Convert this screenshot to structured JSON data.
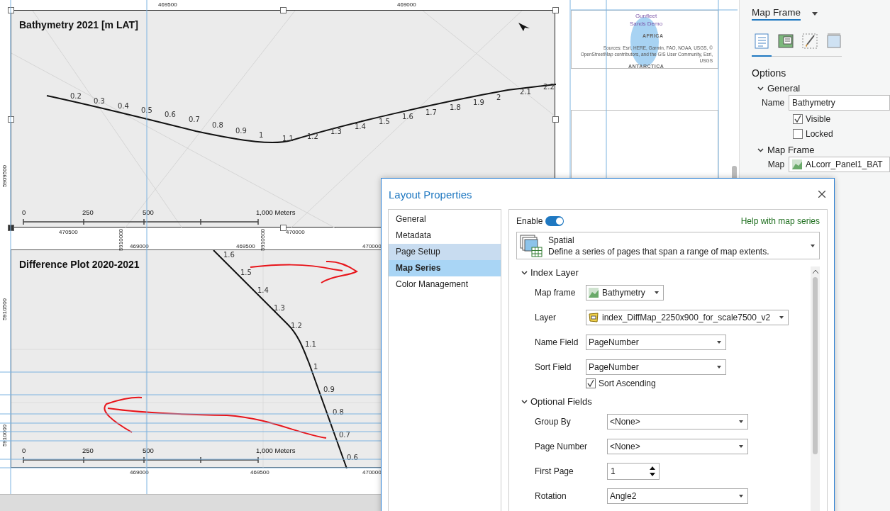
{
  "layout_page": {
    "maps": [
      {
        "title": "Bathymetry 2021 [m LAT]",
        "selected": true,
        "contour_labels": [
          "0.2",
          "0.3",
          "0.4",
          "0.5",
          "0.6",
          "0.7",
          "0.8",
          "0.9",
          "1",
          "1.1",
          "1.2",
          "1.3",
          "1.4",
          "1.5",
          "1.6",
          "1.7",
          "1.8",
          "1.9",
          "2",
          "2.1",
          "2.2"
        ],
        "grid_labels": [
          "469500",
          "469000",
          "470500",
          "470000",
          "5909500"
        ],
        "scale_bar": [
          "0",
          "250",
          "500",
          "1,000 Meters"
        ]
      },
      {
        "title": "Difference Plot 2020-2021",
        "selected": false,
        "contour_labels": [
          "1.6",
          "1.5",
          "1.4",
          "1.3",
          "1.2",
          "1.1",
          "1",
          "0.9",
          "0.8",
          "0.7",
          "0.6"
        ],
        "grid_labels": [
          "469000",
          "469500",
          "470000",
          "469000",
          "469500",
          "470000",
          "5910000",
          "5910500",
          "5910500",
          "5910000"
        ],
        "scale_bar": [
          "0",
          "250",
          "500",
          "1,000 Meters"
        ]
      }
    ],
    "overview_map": {
      "title": "Gunfleet Sands Demo",
      "labels": [
        "AFRICA",
        "ANTARCTICA"
      ],
      "attribution": "Sources: Esri, HERE, Garmin, FAO, NOAA, USGS, © OpenStreetMap contributors, and the GIS User Community, Esri, USGS"
    }
  },
  "format_pane": {
    "title": "Map Frame",
    "tabs": [
      {
        "selected": true
      },
      {
        "selected": false
      },
      {
        "selected": false
      },
      {
        "selected": false
      }
    ],
    "heading": "Options",
    "sections": [
      {
        "title": "General",
        "expanded": true,
        "rows": [
          {
            "kind": "text",
            "label": "Name",
            "value": "Bathymetry"
          },
          {
            "kind": "checkbox",
            "label": "Visible",
            "checked": true
          },
          {
            "kind": "checkbox",
            "label": "Locked",
            "checked": false
          }
        ]
      },
      {
        "title": "Map Frame",
        "expanded": true,
        "rows": [
          {
            "kind": "map-picker",
            "label": "Map",
            "value": "ALcorr_Panel1_BAT"
          }
        ]
      }
    ]
  },
  "dialog": {
    "title": "Layout Properties",
    "nav": [
      {
        "label": "General",
        "selected": false,
        "hovered": false
      },
      {
        "label": "Metadata",
        "selected": false,
        "hovered": false
      },
      {
        "label": "Page Setup",
        "selected": false,
        "hovered": true
      },
      {
        "label": "Map Series",
        "selected": true,
        "hovered": false
      },
      {
        "label": "Color Management",
        "selected": false,
        "hovered": false
      }
    ],
    "enable": {
      "label": "Enable",
      "on": true
    },
    "help_link": "Help with map series",
    "series_type": {
      "title": "Spatial",
      "description": "Define a series of pages that span a range of map extents."
    },
    "sections": [
      {
        "title": "Index Layer",
        "expanded": true,
        "rows": [
          {
            "kind": "map-picker",
            "label": "Map frame",
            "value": "Bathymetry"
          },
          {
            "kind": "layer-picker",
            "label": "Layer",
            "value": "index_DiffMap_2250x900_for_scale7500_v2"
          },
          {
            "kind": "dropdown",
            "label": "Name Field",
            "value": "PageNumber"
          },
          {
            "kind": "dropdown",
            "label": "Sort Field",
            "value": "PageNumber"
          },
          {
            "kind": "checkbox",
            "label": "Sort Ascending",
            "checked": true
          }
        ]
      },
      {
        "title": "Optional Fields",
        "expanded": true,
        "rows": [
          {
            "kind": "dropdown",
            "label": "Group By",
            "value": "<None>"
          },
          {
            "kind": "dropdown",
            "label": "Page Number",
            "value": "<None>"
          },
          {
            "kind": "spinner",
            "label": "First Page",
            "value": "1"
          },
          {
            "kind": "dropdown",
            "label": "Rotation",
            "value": "Angle2"
          }
        ]
      }
    ]
  }
}
